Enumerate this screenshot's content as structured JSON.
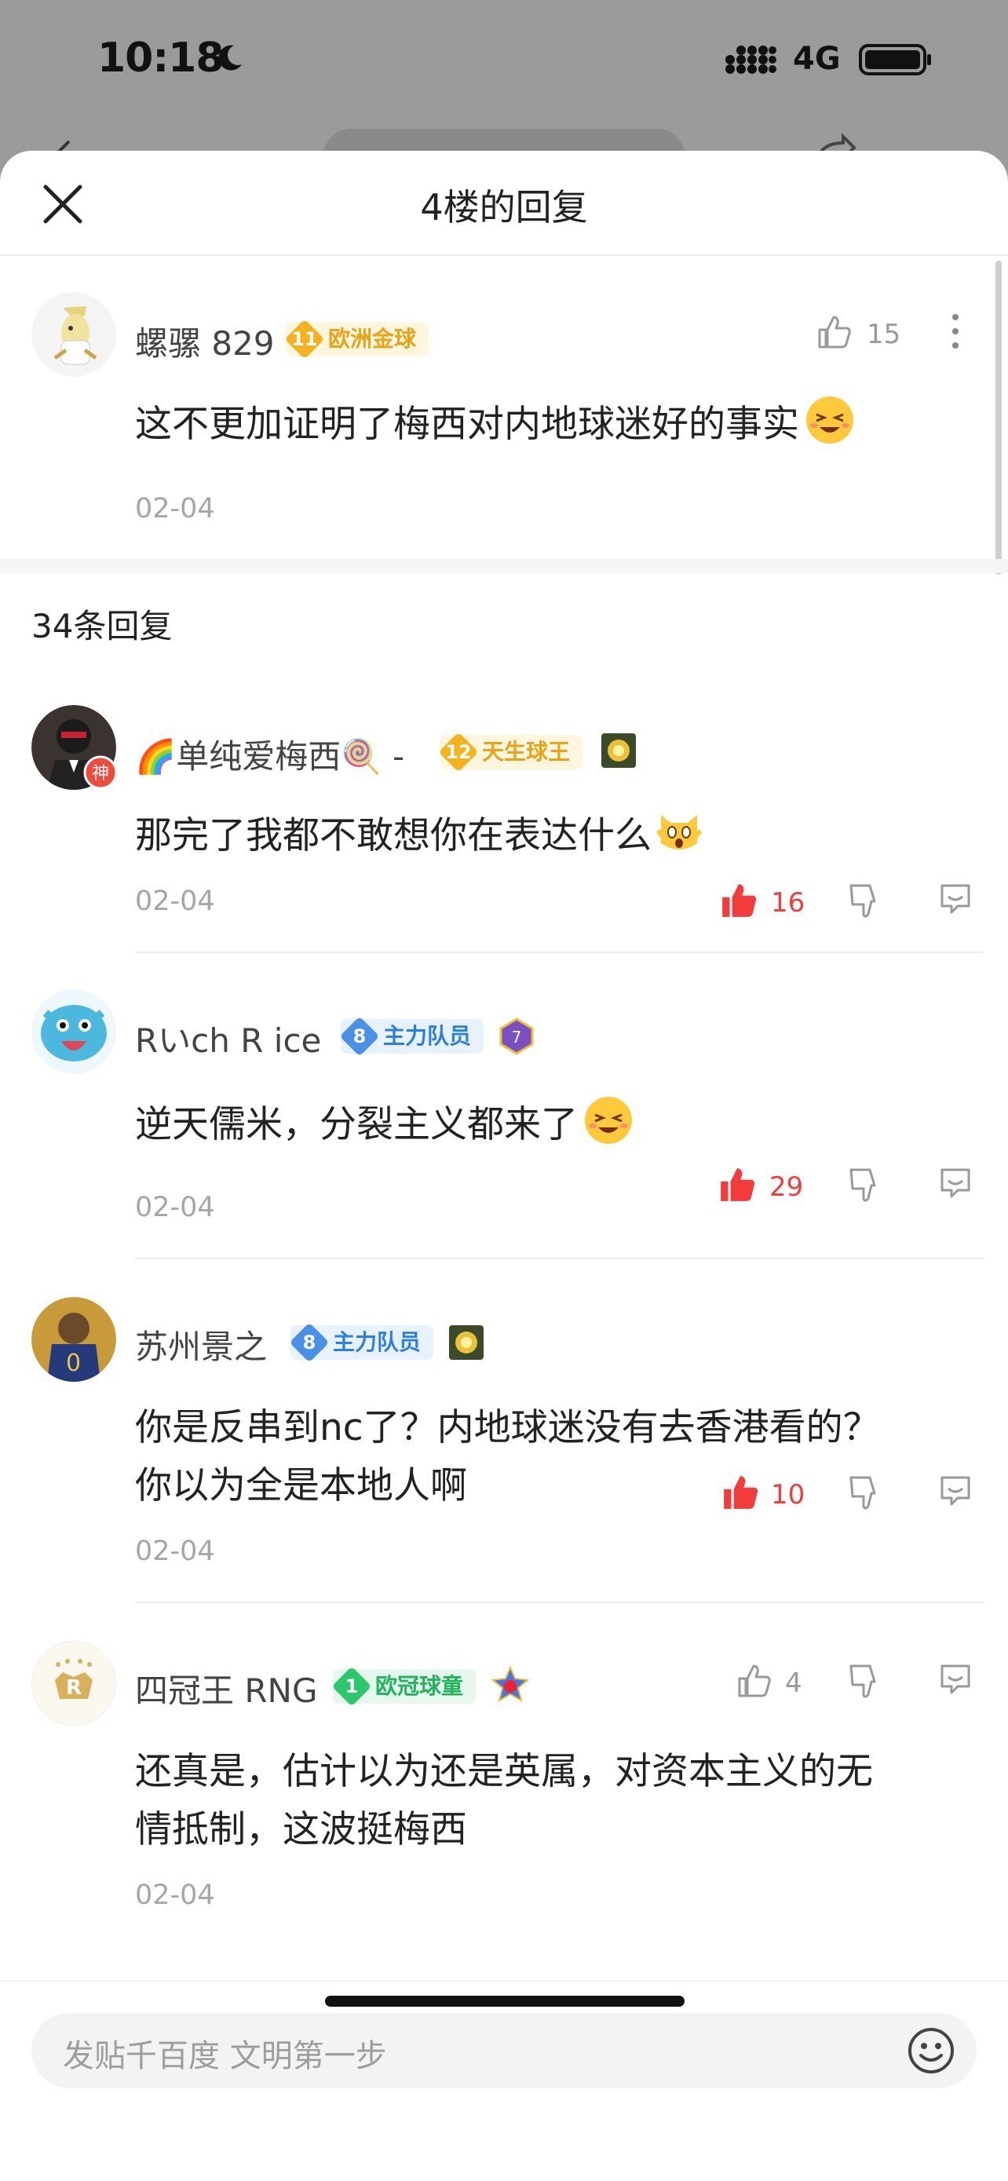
{
  "status_bar": {
    "time": "10:18",
    "network": "4G"
  },
  "sheet": {
    "title": "4楼的回复"
  },
  "main_post": {
    "username": "螺骡 829",
    "badge_level": "11",
    "badge_label": "欧洲金球",
    "likes": "15",
    "text": "这不更加证明了梅西对内地球迷好的事实",
    "date": "02-04"
  },
  "replies_count_label": "34条回复",
  "replies": [
    {
      "username": "🌈单纯爱梅西🍭 -",
      "avatar_tag": "神",
      "badge_level": "12",
      "badge_label": "天生球王",
      "likes": "16",
      "text": "那完了我都不敢想你在表达什么",
      "date": "02-04"
    },
    {
      "username": "Rいch R ice",
      "badge_level": "8",
      "badge_label": "主力队员",
      "likes": "29",
      "text": "逆天儒米，分裂主义都来了",
      "date": "02-04"
    },
    {
      "username": "苏州景之",
      "badge_level": "8",
      "badge_label": "主力队员",
      "likes": "10",
      "text_line1": "你是反串到nc了？内地球迷没有去香港看的？",
      "text_line2": "你以为全是本地人啊",
      "date": "02-04"
    },
    {
      "username": "四冠王 RNG",
      "badge_level": "1",
      "badge_label": "欧冠球童",
      "likes": "4",
      "text_line1": "还真是，估计以为还是英属，对资本主义的无",
      "text_line2": "情抵制，这波挺梅西",
      "date": "02-04"
    }
  ],
  "input": {
    "placeholder": "发贴千百度 文明第一步"
  },
  "colors": {
    "liked_red": "#f23b3b",
    "gold_badge": "#f5b21f",
    "blue_badge": "#4a90e8",
    "green_badge": "#2bc86b"
  }
}
